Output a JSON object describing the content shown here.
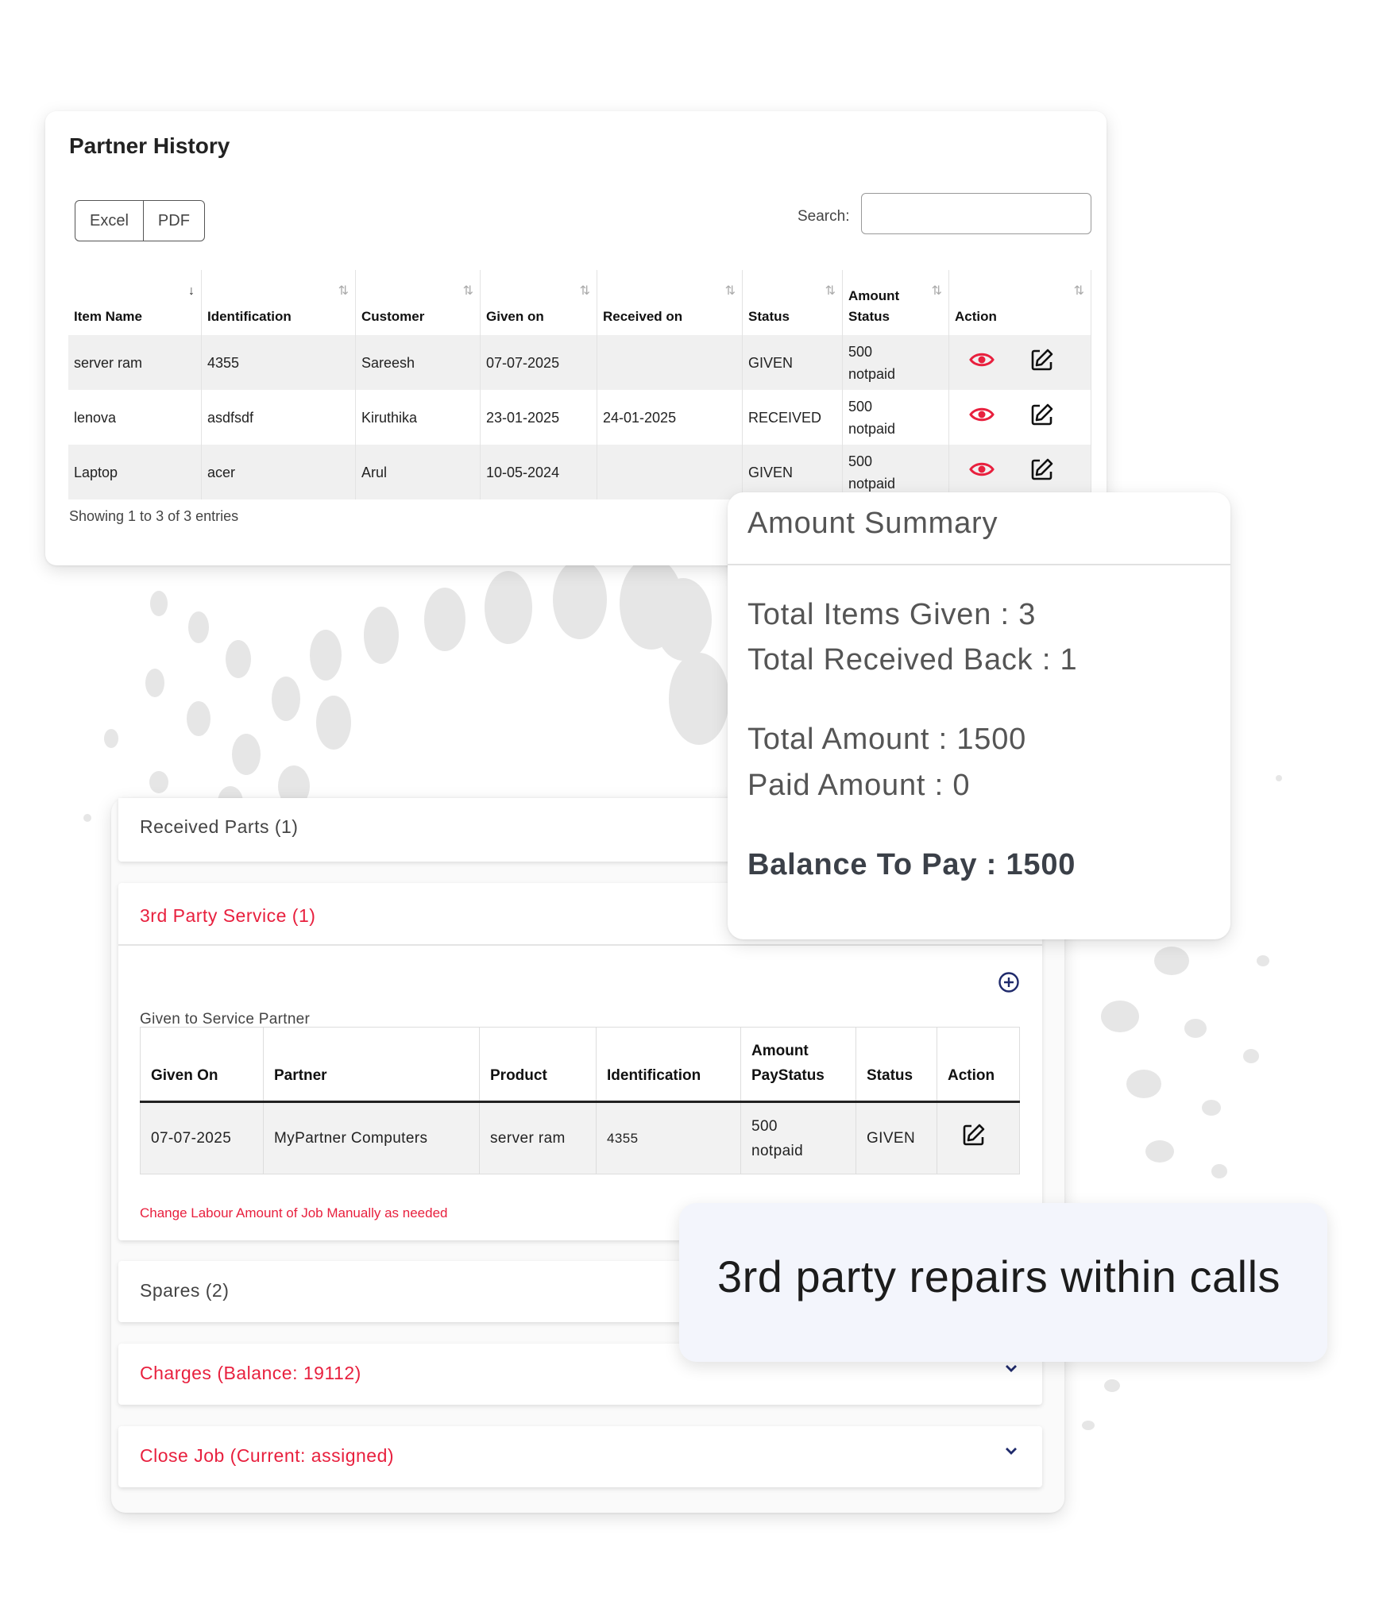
{
  "partner_history": {
    "title": "Partner History",
    "buttons": {
      "excel": "Excel",
      "pdf": "PDF"
    },
    "search": {
      "label": "Search:",
      "value": "",
      "placeholder": ""
    },
    "columns": [
      "Item Name",
      "Identification",
      "Customer",
      "Given on",
      "Received on",
      "Status",
      "Amount Status",
      "Action"
    ],
    "rows": [
      {
        "item_name": "server ram",
        "identification": "4355",
        "customer": "Sareesh",
        "given_on": "07-07-2025",
        "received_on": "",
        "status": "GIVEN",
        "amount": "500",
        "pay_status": "notpaid"
      },
      {
        "item_name": "lenova",
        "identification": "asdfsdf",
        "customer": "Kiruthika",
        "given_on": "23-01-2025",
        "received_on": "24-01-2025",
        "status": "RECEIVED",
        "amount": "500",
        "pay_status": "notpaid"
      },
      {
        "item_name": "Laptop",
        "identification": "acer",
        "customer": "Arul",
        "given_on": "10-05-2024",
        "received_on": "",
        "status": "GIVEN",
        "amount": "500",
        "pay_status": "notpaid"
      }
    ],
    "showing": "Showing 1 to 3 of 3 entries"
  },
  "amount_summary": {
    "title": "Amount Summary",
    "total_items_given": "Total Items Given : 3",
    "total_received_back": "Total Received Back : 1",
    "total_amount": "Total Amount : 1500",
    "paid_amount": "Paid Amount : 0",
    "balance_to_pay": "Balance To Pay : 1500"
  },
  "accordion": {
    "received_parts": "Received Parts (1)",
    "third_party": {
      "header": "3rd Party Service (1)",
      "sub_label": "Given to Service Partner",
      "columns": [
        "Given On",
        "Partner",
        "Product",
        "Identification",
        "Amount PayStatus",
        "Status",
        "Action"
      ],
      "rows": [
        {
          "given_on": "07-07-2025",
          "partner": "MyPartner Computers",
          "product": "server ram",
          "identification": "4355",
          "amount": "500",
          "pay_status": "notpaid",
          "status": "GIVEN"
        }
      ],
      "note": "Change Labour Amount of Job Manually as needed"
    },
    "spares": "Spares (2)",
    "charges": "Charges (Balance: 19112)",
    "close_job": "Close Job (Current: assigned)"
  },
  "caption": "3rd party repairs within calls",
  "colors": {
    "accent_red": "#e8203e",
    "navy": "#1f2a6b",
    "eye_icon": "#e8203e"
  },
  "icons": {
    "view": "eye-icon",
    "edit": "edit-icon",
    "add": "plus-circle-icon",
    "expand": "chevron-down-icon"
  }
}
